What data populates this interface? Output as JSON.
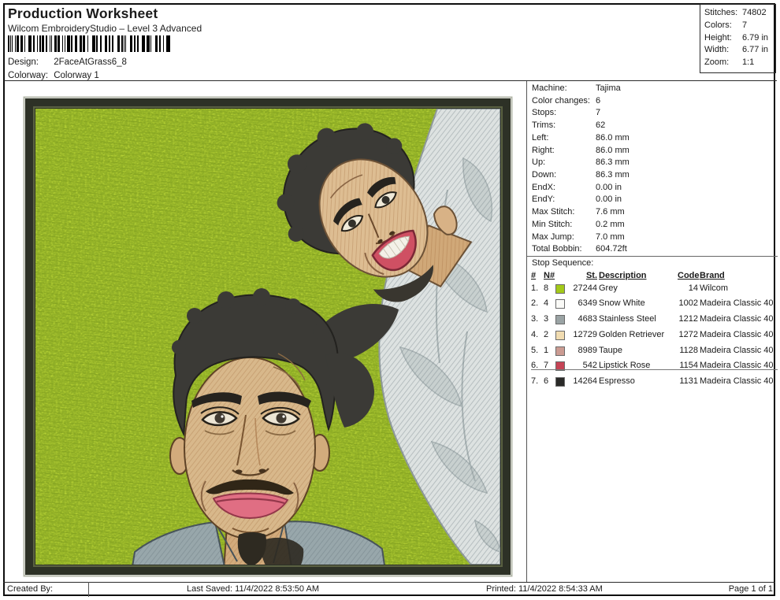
{
  "header": {
    "title": "Production Worksheet",
    "subtitle": "Wilcom EmbroideryStudio – Level 3 Advanced",
    "design_label": "Design:",
    "design_value": "2FaceAtGrass6_8",
    "colorway_label": "Colorway:",
    "colorway_value": "Colorway 1"
  },
  "summary": {
    "rows": [
      {
        "label": "Stitches:",
        "value": "74802"
      },
      {
        "label": "Colors:",
        "value": "7"
      },
      {
        "label": "Height:",
        "value": "6.79 in"
      },
      {
        "label": "Width:",
        "value": "6.77 in"
      },
      {
        "label": "Zoom:",
        "value": "1:1"
      }
    ]
  },
  "machine_info": {
    "rows": [
      {
        "label": "Machine:",
        "value": "Tajima"
      },
      {
        "label": "Color changes:",
        "value": "6"
      },
      {
        "label": "Stops:",
        "value": "7"
      },
      {
        "label": "Trims:",
        "value": "62"
      },
      {
        "label": "Left:",
        "value": "86.0 mm"
      },
      {
        "label": "Right:",
        "value": "86.0 mm"
      },
      {
        "label": "Up:",
        "value": "86.3 mm"
      },
      {
        "label": "Down:",
        "value": "86.3 mm"
      },
      {
        "label": "EndX:",
        "value": "0.00 in"
      },
      {
        "label": "EndY:",
        "value": "0.00 in"
      },
      {
        "label": "Max Stitch:",
        "value": "7.6 mm"
      },
      {
        "label": "Min Stitch:",
        "value": "0.2 mm"
      },
      {
        "label": "Max Jump:",
        "value": "7.0 mm"
      },
      {
        "label": "Total Bobbin:",
        "value": "604.72ft"
      }
    ]
  },
  "stop_sequence": {
    "title": "Stop Sequence:",
    "columns": {
      "num": "#",
      "needle": "N#",
      "stitches": "St.",
      "description": "Description",
      "code": "Code",
      "brand": "Brand"
    },
    "rows": [
      {
        "num": "1.",
        "needle": "8",
        "color": "#a3c919",
        "stitches": "27244",
        "description": "Grey",
        "code": "14",
        "brand": "Wilcom"
      },
      {
        "num": "2.",
        "needle": "4",
        "color": "#fafaf7",
        "stitches": "6349",
        "description": "Snow White",
        "code": "1002",
        "brand": "Madeira Classic 40"
      },
      {
        "num": "3.",
        "needle": "3",
        "color": "#9aa3a4",
        "stitches": "4683",
        "description": "Stainless Steel",
        "code": "1212",
        "brand": "Madeira Classic 40"
      },
      {
        "num": "4.",
        "needle": "2",
        "color": "#f1dcb1",
        "stitches": "12729",
        "description": "Golden Retriever",
        "code": "1272",
        "brand": "Madeira Classic 40"
      },
      {
        "num": "5.",
        "needle": "1",
        "color": "#cb9b92",
        "stitches": "8989",
        "description": "Taupe",
        "code": "1128",
        "brand": "Madeira Classic 40"
      },
      {
        "num": "6.",
        "needle": "7",
        "color": "#c64456",
        "stitches": "542",
        "description": "Lipstick Rose",
        "code": "1154",
        "brand": "Madeira Classic 40"
      },
      {
        "num": "7.",
        "needle": "6",
        "color": "#2a2a28",
        "stitches": "14264",
        "description": "Espresso",
        "code": "1131",
        "brand": "Madeira Classic 40"
      }
    ]
  },
  "design_preview": {
    "background_color": "#b7d336",
    "frame_color": "#2e3226"
  },
  "footer": {
    "created_by": "Created By:",
    "last_saved": "Last Saved: 11/4/2022 8:53:50 AM",
    "printed": "Printed: 11/4/2022 8:54:33 AM",
    "page": "Page 1 of 1"
  }
}
